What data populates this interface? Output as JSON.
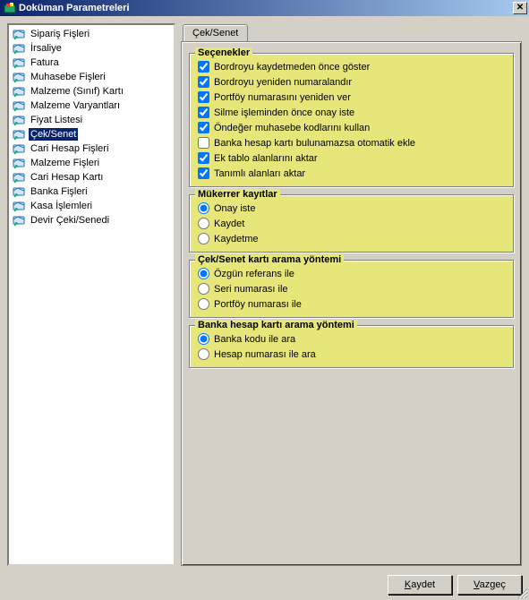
{
  "window": {
    "title": "Doküman Parametreleri"
  },
  "sidebar": {
    "items": [
      {
        "label": "Sipariş Fişleri"
      },
      {
        "label": "İrsaliye"
      },
      {
        "label": "Fatura"
      },
      {
        "label": "Muhasebe Fişleri"
      },
      {
        "label": "Malzeme (Sınıf) Kartı"
      },
      {
        "label": "Malzeme Varyantları"
      },
      {
        "label": "Fiyat Listesi"
      },
      {
        "label": "Çek/Senet"
      },
      {
        "label": "Cari Hesap Fişleri"
      },
      {
        "label": "Malzeme Fişleri"
      },
      {
        "label": "Cari Hesap Kartı"
      },
      {
        "label": "Banka Fişleri"
      },
      {
        "label": "Kasa İşlemleri"
      },
      {
        "label": "Devir Çeki/Senedi"
      }
    ],
    "selected_index": 7
  },
  "tabs": {
    "active": "Çek/Senet"
  },
  "groups": {
    "secenekler": {
      "legend": "Seçenekler",
      "items": [
        {
          "label": "Bordroyu kaydetmeden önce göster",
          "checked": true
        },
        {
          "label": "Bordroyu yeniden numaralandır",
          "checked": true
        },
        {
          "label": "Portföy numarasını yeniden ver",
          "checked": true
        },
        {
          "label": "Silme işleminden önce onay iste",
          "checked": true
        },
        {
          "label": "Öndeğer muhasebe kodlarını kullan",
          "checked": true
        },
        {
          "label": "Banka hesap kartı bulunamazsa otomatik ekle",
          "checked": false
        },
        {
          "label": "Ek tablo alanlarını aktar",
          "checked": true
        },
        {
          "label": "Tanımlı alanları aktar",
          "checked": true
        }
      ]
    },
    "mukerrer": {
      "legend": "Mükerrer kayıtlar",
      "items": [
        {
          "label": "Onay iste"
        },
        {
          "label": "Kaydet"
        },
        {
          "label": "Kaydetme"
        }
      ],
      "selected": 0
    },
    "arama": {
      "legend": "Çek/Senet kartı arama yöntemi",
      "items": [
        {
          "label": "Özgün referans ile"
        },
        {
          "label": "Seri numarası ile"
        },
        {
          "label": "Portföy numarası ile"
        }
      ],
      "selected": 0
    },
    "banka": {
      "legend": "Banka hesap kartı arama yöntemi",
      "items": [
        {
          "label": "Banka kodu ile ara"
        },
        {
          "label": "Hesap numarası ile ara"
        }
      ],
      "selected": 0
    }
  },
  "buttons": {
    "save": "Kaydet",
    "cancel": "Vazgeç",
    "save_u": "K",
    "cancel_u": "V"
  }
}
